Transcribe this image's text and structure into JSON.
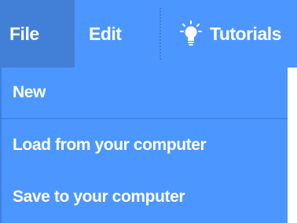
{
  "menubar": {
    "file_label": "File",
    "edit_label": "Edit",
    "tutorials_label": "Tutorials",
    "tutorials_icon": "lightbulb-icon"
  },
  "dropdown": {
    "items": [
      {
        "label": "New"
      },
      {
        "label": "Load from your computer"
      },
      {
        "label": "Save to your computer"
      }
    ]
  },
  "colors": {
    "menubar_bg": "#4C97FF",
    "active_menu_bg": "#4280D7",
    "text": "#FFFFFF"
  }
}
